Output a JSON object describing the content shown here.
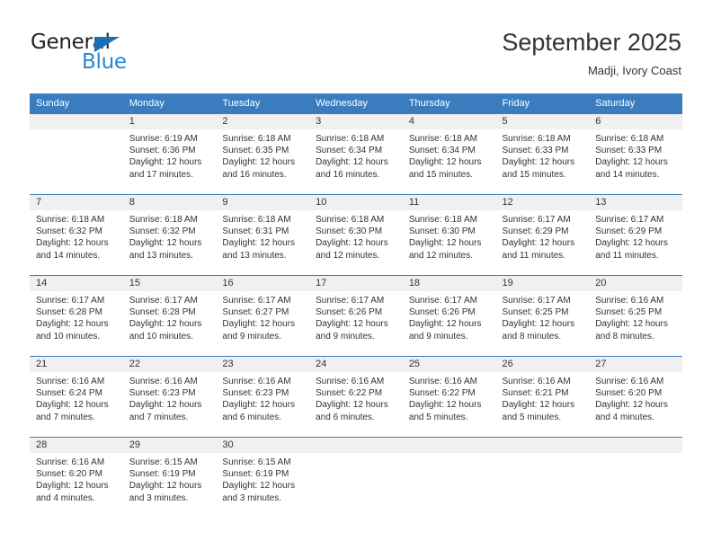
{
  "logo": {
    "primary_text": "General",
    "secondary_text": "Blue",
    "triangle_color": "#1c6fb5",
    "primary_color": "#231f20",
    "secondary_color": "#2787d4"
  },
  "header": {
    "title": "September 2025",
    "subtitle": "Madji, Ivory Coast"
  },
  "theme": {
    "header_bg": "#3a7cbe",
    "header_text": "#ffffff",
    "daynum_bg": "#f0f0f0",
    "body_text": "#333333"
  },
  "weekday_headers": [
    "Sunday",
    "Monday",
    "Tuesday",
    "Wednesday",
    "Thursday",
    "Friday",
    "Saturday"
  ],
  "labels": {
    "sunrise_prefix": "Sunrise:",
    "sunset_prefix": "Sunset:",
    "daylight_prefix": "Daylight:"
  },
  "weeks": [
    [
      {
        "day": "",
        "sunrise": "",
        "sunset": "",
        "daylight": "",
        "empty": true
      },
      {
        "day": "1",
        "sunrise": "Sunrise: 6:19 AM",
        "sunset": "Sunset: 6:36 PM",
        "daylight": "Daylight: 12 hours and 17 minutes."
      },
      {
        "day": "2",
        "sunrise": "Sunrise: 6:18 AM",
        "sunset": "Sunset: 6:35 PM",
        "daylight": "Daylight: 12 hours and 16 minutes."
      },
      {
        "day": "3",
        "sunrise": "Sunrise: 6:18 AM",
        "sunset": "Sunset: 6:34 PM",
        "daylight": "Daylight: 12 hours and 16 minutes."
      },
      {
        "day": "4",
        "sunrise": "Sunrise: 6:18 AM",
        "sunset": "Sunset: 6:34 PM",
        "daylight": "Daylight: 12 hours and 15 minutes."
      },
      {
        "day": "5",
        "sunrise": "Sunrise: 6:18 AM",
        "sunset": "Sunset: 6:33 PM",
        "daylight": "Daylight: 12 hours and 15 minutes."
      },
      {
        "day": "6",
        "sunrise": "Sunrise: 6:18 AM",
        "sunset": "Sunset: 6:33 PM",
        "daylight": "Daylight: 12 hours and 14 minutes."
      }
    ],
    [
      {
        "day": "7",
        "sunrise": "Sunrise: 6:18 AM",
        "sunset": "Sunset: 6:32 PM",
        "daylight": "Daylight: 12 hours and 14 minutes."
      },
      {
        "day": "8",
        "sunrise": "Sunrise: 6:18 AM",
        "sunset": "Sunset: 6:32 PM",
        "daylight": "Daylight: 12 hours and 13 minutes."
      },
      {
        "day": "9",
        "sunrise": "Sunrise: 6:18 AM",
        "sunset": "Sunset: 6:31 PM",
        "daylight": "Daylight: 12 hours and 13 minutes."
      },
      {
        "day": "10",
        "sunrise": "Sunrise: 6:18 AM",
        "sunset": "Sunset: 6:30 PM",
        "daylight": "Daylight: 12 hours and 12 minutes."
      },
      {
        "day": "11",
        "sunrise": "Sunrise: 6:18 AM",
        "sunset": "Sunset: 6:30 PM",
        "daylight": "Daylight: 12 hours and 12 minutes."
      },
      {
        "day": "12",
        "sunrise": "Sunrise: 6:17 AM",
        "sunset": "Sunset: 6:29 PM",
        "daylight": "Daylight: 12 hours and 11 minutes."
      },
      {
        "day": "13",
        "sunrise": "Sunrise: 6:17 AM",
        "sunset": "Sunset: 6:29 PM",
        "daylight": "Daylight: 12 hours and 11 minutes."
      }
    ],
    [
      {
        "day": "14",
        "sunrise": "Sunrise: 6:17 AM",
        "sunset": "Sunset: 6:28 PM",
        "daylight": "Daylight: 12 hours and 10 minutes."
      },
      {
        "day": "15",
        "sunrise": "Sunrise: 6:17 AM",
        "sunset": "Sunset: 6:28 PM",
        "daylight": "Daylight: 12 hours and 10 minutes."
      },
      {
        "day": "16",
        "sunrise": "Sunrise: 6:17 AM",
        "sunset": "Sunset: 6:27 PM",
        "daylight": "Daylight: 12 hours and 9 minutes."
      },
      {
        "day": "17",
        "sunrise": "Sunrise: 6:17 AM",
        "sunset": "Sunset: 6:26 PM",
        "daylight": "Daylight: 12 hours and 9 minutes."
      },
      {
        "day": "18",
        "sunrise": "Sunrise: 6:17 AM",
        "sunset": "Sunset: 6:26 PM",
        "daylight": "Daylight: 12 hours and 9 minutes."
      },
      {
        "day": "19",
        "sunrise": "Sunrise: 6:17 AM",
        "sunset": "Sunset: 6:25 PM",
        "daylight": "Daylight: 12 hours and 8 minutes."
      },
      {
        "day": "20",
        "sunrise": "Sunrise: 6:16 AM",
        "sunset": "Sunset: 6:25 PM",
        "daylight": "Daylight: 12 hours and 8 minutes."
      }
    ],
    [
      {
        "day": "21",
        "sunrise": "Sunrise: 6:16 AM",
        "sunset": "Sunset: 6:24 PM",
        "daylight": "Daylight: 12 hours and 7 minutes."
      },
      {
        "day": "22",
        "sunrise": "Sunrise: 6:16 AM",
        "sunset": "Sunset: 6:23 PM",
        "daylight": "Daylight: 12 hours and 7 minutes."
      },
      {
        "day": "23",
        "sunrise": "Sunrise: 6:16 AM",
        "sunset": "Sunset: 6:23 PM",
        "daylight": "Daylight: 12 hours and 6 minutes."
      },
      {
        "day": "24",
        "sunrise": "Sunrise: 6:16 AM",
        "sunset": "Sunset: 6:22 PM",
        "daylight": "Daylight: 12 hours and 6 minutes."
      },
      {
        "day": "25",
        "sunrise": "Sunrise: 6:16 AM",
        "sunset": "Sunset: 6:22 PM",
        "daylight": "Daylight: 12 hours and 5 minutes."
      },
      {
        "day": "26",
        "sunrise": "Sunrise: 6:16 AM",
        "sunset": "Sunset: 6:21 PM",
        "daylight": "Daylight: 12 hours and 5 minutes."
      },
      {
        "day": "27",
        "sunrise": "Sunrise: 6:16 AM",
        "sunset": "Sunset: 6:20 PM",
        "daylight": "Daylight: 12 hours and 4 minutes."
      }
    ],
    [
      {
        "day": "28",
        "sunrise": "Sunrise: 6:16 AM",
        "sunset": "Sunset: 6:20 PM",
        "daylight": "Daylight: 12 hours and 4 minutes."
      },
      {
        "day": "29",
        "sunrise": "Sunrise: 6:15 AM",
        "sunset": "Sunset: 6:19 PM",
        "daylight": "Daylight: 12 hours and 3 minutes."
      },
      {
        "day": "30",
        "sunrise": "Sunrise: 6:15 AM",
        "sunset": "Sunset: 6:19 PM",
        "daylight": "Daylight: 12 hours and 3 minutes."
      },
      {
        "day": "",
        "sunrise": "",
        "sunset": "",
        "daylight": "",
        "empty": true
      },
      {
        "day": "",
        "sunrise": "",
        "sunset": "",
        "daylight": "",
        "empty": true
      },
      {
        "day": "",
        "sunrise": "",
        "sunset": "",
        "daylight": "",
        "empty": true
      },
      {
        "day": "",
        "sunrise": "",
        "sunset": "",
        "daylight": "",
        "empty": true
      }
    ]
  ]
}
